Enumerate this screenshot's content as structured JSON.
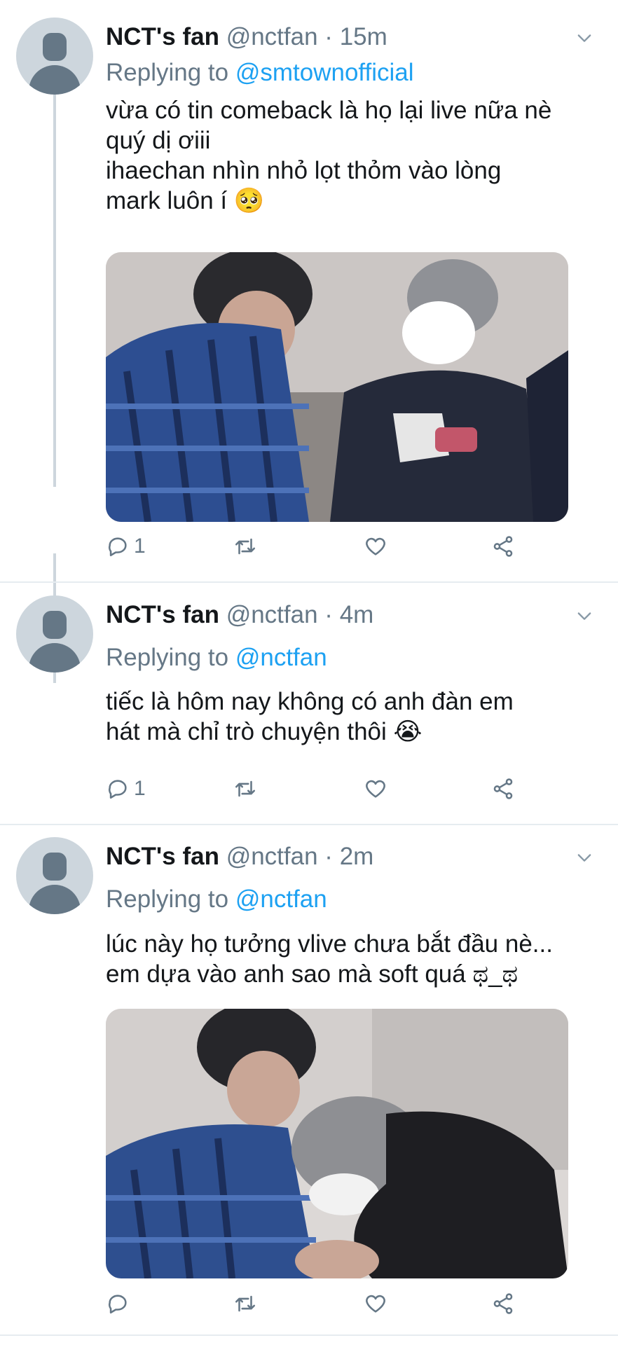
{
  "tweets": [
    {
      "name": "NCT's fan",
      "handle": "@nctfan",
      "time": "15m",
      "replying_label": "Replying to ",
      "replying_to": "@smtownofficial",
      "text": "vừa có tin comeback là họ lại live nữa nè\nquý dị ơiii\nihaechan nhìn nhỏ lọt thỏm vào lòng\nmark luôn í 🥺",
      "reply_count": "1",
      "has_media": true
    },
    {
      "name": "NCT's fan",
      "handle": "@nctfan",
      "time": "4m",
      "replying_label": "Replying to ",
      "replying_to": "@nctfan",
      "text": "tiếc là hôm nay không có anh đàn em\nhát mà chỉ trò chuyện thôi 😭",
      "reply_count": "1",
      "has_media": false
    },
    {
      "name": "NCT's fan",
      "handle": "@nctfan",
      "time": "2m",
      "replying_label": "Replying to ",
      "replying_to": "@nctfan",
      "text": "lúc này họ tưởng vlive chưa bắt đầu nè...\nem dựa vào anh sao mà soft quá ಥ_ಥ",
      "reply_count": "",
      "has_media": true
    }
  ],
  "icons": {
    "reply": "reply-icon",
    "retweet": "retweet-icon",
    "like": "heart-icon",
    "share": "share-icon",
    "more": "chevron-down-icon"
  },
  "colors": {
    "link": "#1da1f2",
    "secondary_text": "#657786",
    "thread_line": "#cdd6dd"
  }
}
